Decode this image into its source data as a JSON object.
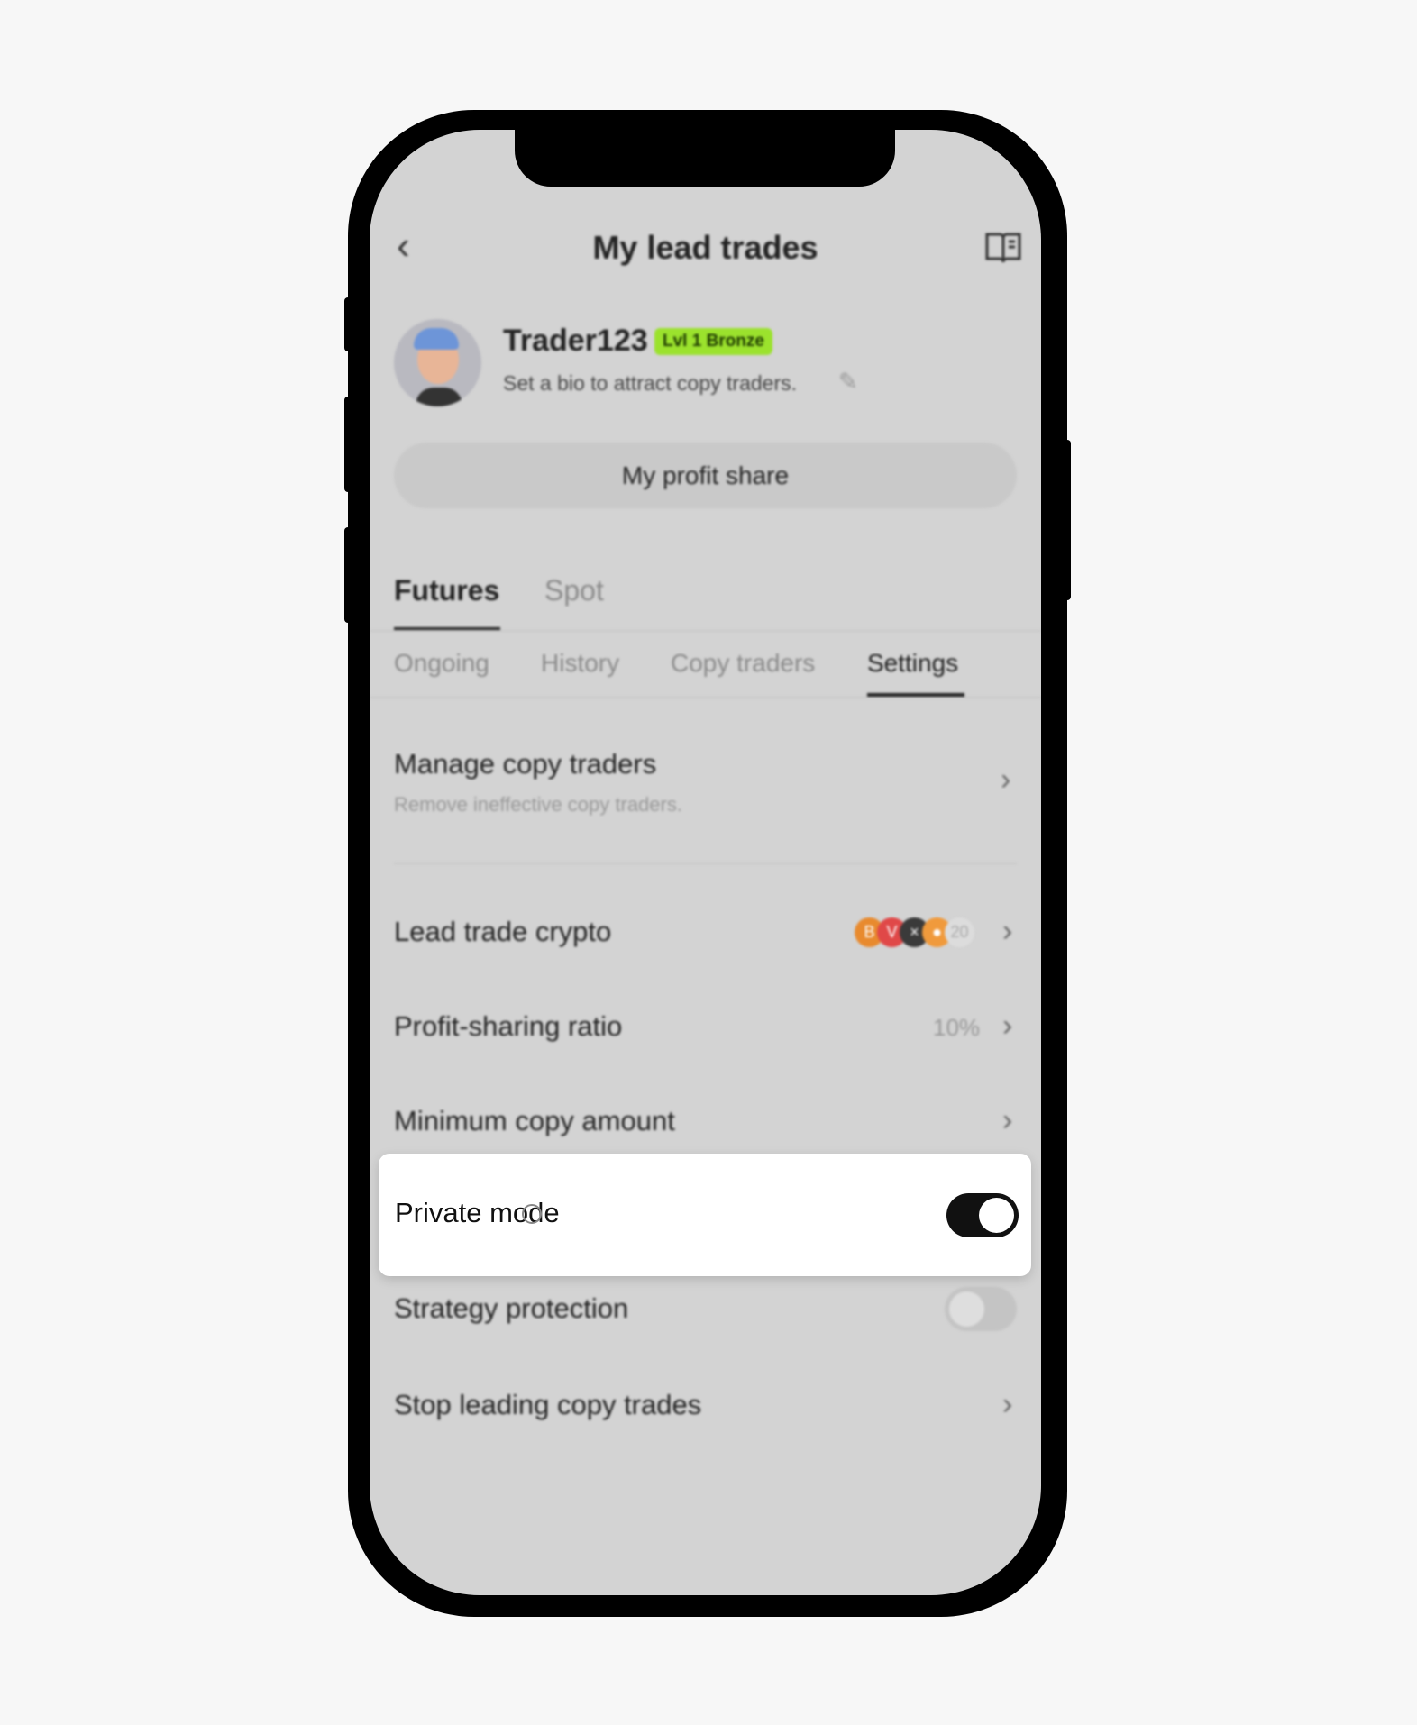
{
  "header": {
    "title": "My lead trades",
    "back_icon": "chevron-left-icon",
    "guide_icon": "book-icon"
  },
  "profile": {
    "name": "Trader123",
    "badge": "Lvl 1 Bronze",
    "badge_color": "#9be22d",
    "bio": "Set a bio to attract copy traders."
  },
  "profit_share_button": "My profit share",
  "market_tabs": [
    {
      "label": "Futures",
      "active": true
    },
    {
      "label": "Spot",
      "active": false
    }
  ],
  "sub_tabs": [
    {
      "label": "Ongoing"
    },
    {
      "label": "History"
    },
    {
      "label": "Copy traders"
    },
    {
      "label": "Settings",
      "active": true
    }
  ],
  "settings": {
    "manage": {
      "label": "Manage copy traders",
      "desc": "Remove ineffective copy traders."
    },
    "crypto": {
      "label": "Lead trade crypto",
      "more_count": "20"
    },
    "ratio": {
      "label": "Profit-sharing ratio",
      "value": "10%"
    },
    "minimum": {
      "label": "Minimum copy amount"
    },
    "private": {
      "label": "Private mode",
      "enabled": true
    },
    "strategy": {
      "label": "Strategy protection",
      "enabled": false
    },
    "stop": {
      "label": "Stop leading copy trades"
    }
  }
}
